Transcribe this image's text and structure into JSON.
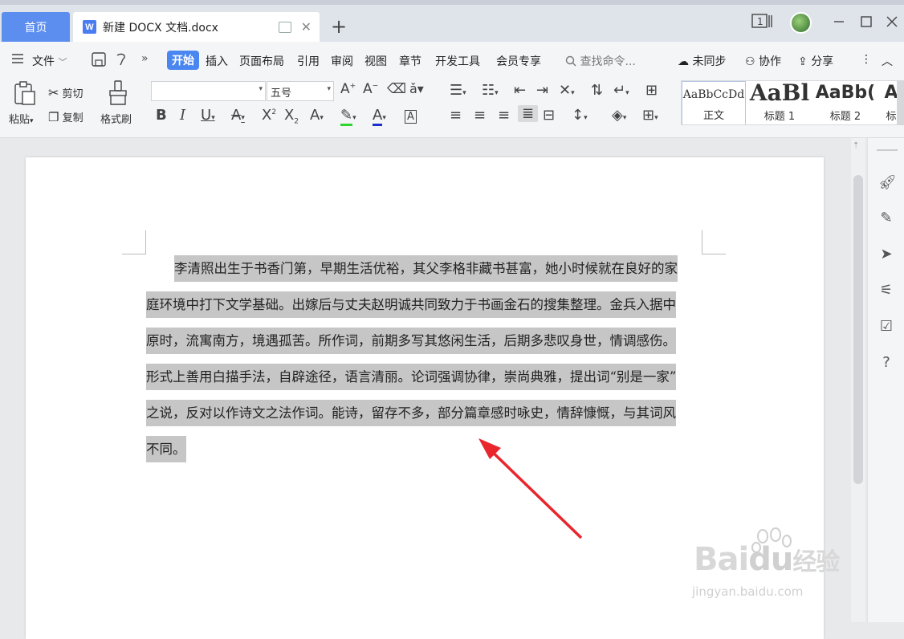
{
  "tabs": {
    "home": "首页",
    "doc_name": "新建 DOCX 文档.docx",
    "doc_icon": "W"
  },
  "window": {
    "page_count_badge": "1"
  },
  "menu": {
    "file": "文件",
    "items": [
      "开始",
      "插入",
      "页面布局",
      "引用",
      "审阅",
      "视图",
      "章节",
      "开发工具",
      "会员专享"
    ],
    "search": "查找命令...",
    "unsync": "未同步",
    "collab": "协作",
    "share": "分享"
  },
  "ribbon": {
    "paste": "粘贴",
    "cut": "剪切",
    "copy": "复制",
    "format_painter": "格式刷",
    "font_name": "",
    "font_size": "五号",
    "styles": [
      {
        "preview": "AaBbCcDd",
        "label": "正文"
      },
      {
        "preview": "AaBl",
        "label": "标题 1"
      },
      {
        "preview": "AaBb(",
        "label": "标题 2"
      },
      {
        "preview": "A",
        "label": "标"
      }
    ]
  },
  "document": {
    "lines": [
      "李清照出生于书香门第，早期生活优裕，其父李格非藏书甚富，她小时候就在良好的家",
      "庭环境中打下文学基础。出嫁后与丈夫赵明诚共同致力于书画金石的搜集整理。金兵入据中",
      "原时，流寓南方，境遇孤苦。所作词，前期多写其悠闲生活，后期多悲叹身世，情调感伤。",
      "形式上善用白描手法，自辟途径，语言清丽。论词强调协律，崇尚典雅，提出词“别是一家”",
      "之说，反对以作诗文之法作词。能诗，留存不多，部分篇章感时咏史，情辞慷慨，与其词风",
      "不同。"
    ]
  },
  "watermark": {
    "brand": "Bai",
    "brand2": "du",
    "cn": "经验",
    "url": "jingyan.baidu.com"
  },
  "colors": {
    "accent": "#4a86f0",
    "home_tab": "#5c8ef0",
    "selection": "#c6c6c6",
    "arrow": "#e8262c"
  }
}
